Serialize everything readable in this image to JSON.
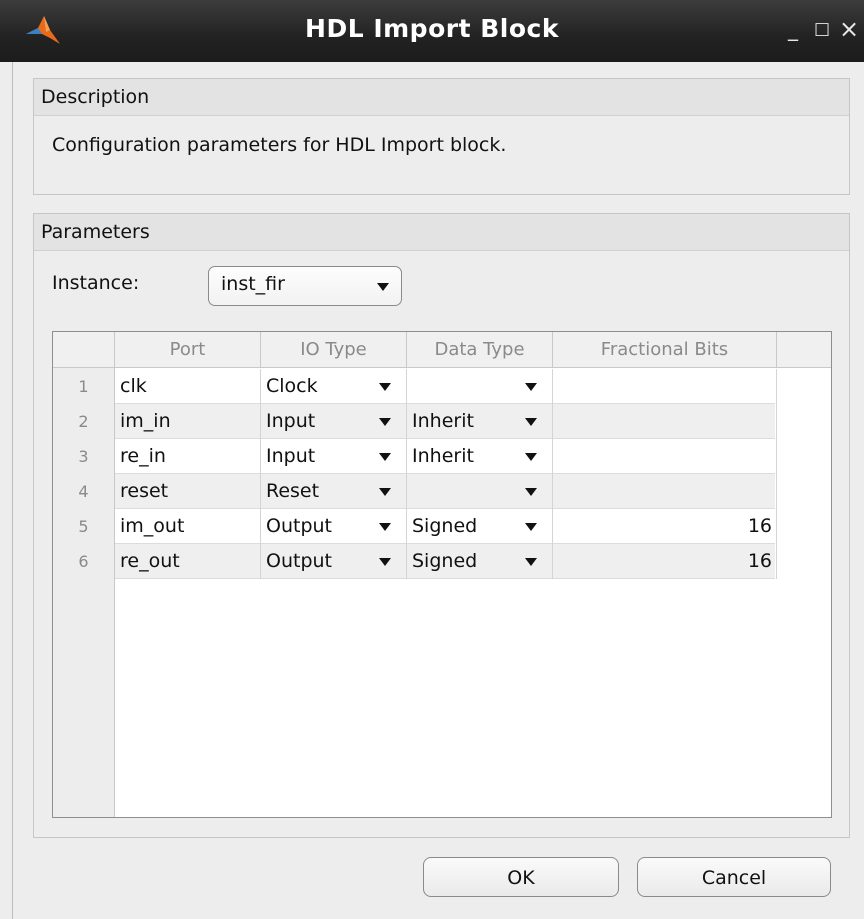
{
  "window": {
    "title": "HDL Import Block",
    "controls": {
      "minimize": "_",
      "maximize": "□",
      "close": "×"
    }
  },
  "description": {
    "header": "Description",
    "text": "Configuration parameters for HDL Import block."
  },
  "parameters": {
    "header": "Parameters",
    "instance_label": "Instance:",
    "instance_value": "inst_fir"
  },
  "table": {
    "columns": [
      "Port",
      "IO Type",
      "Data Type",
      "Fractional Bits"
    ],
    "rows": [
      {
        "num": "1",
        "port": "clk",
        "io_type": "Clock",
        "data_type": "",
        "fractional_bits": ""
      },
      {
        "num": "2",
        "port": "im_in",
        "io_type": "Input",
        "data_type": "Inherit",
        "fractional_bits": ""
      },
      {
        "num": "3",
        "port": "re_in",
        "io_type": "Input",
        "data_type": "Inherit",
        "fractional_bits": ""
      },
      {
        "num": "4",
        "port": "reset",
        "io_type": "Reset",
        "data_type": "",
        "fractional_bits": ""
      },
      {
        "num": "5",
        "port": "im_out",
        "io_type": "Output",
        "data_type": "Signed",
        "fractional_bits": "16"
      },
      {
        "num": "6",
        "port": "re_out",
        "io_type": "Output",
        "data_type": "Signed",
        "fractional_bits": "16"
      }
    ]
  },
  "buttons": {
    "ok": "OK",
    "cancel": "Cancel"
  },
  "colors": {
    "titlebar": "#222222",
    "icon_orange": "#e86a1a",
    "icon_blue": "#3b7fc4"
  }
}
